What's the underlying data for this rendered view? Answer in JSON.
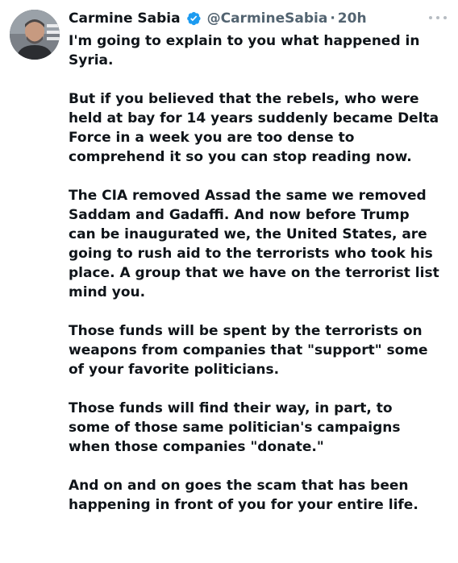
{
  "author": {
    "name": "Carmine Sabia",
    "handle": "@CarmineSabia",
    "separator": "·",
    "time": "20h",
    "verified_color": "#1d9bf0"
  },
  "icons": {
    "verified": "verified-badge-icon",
    "more": "more-options-icon"
  },
  "tweet": {
    "paragraphs": [
      "I'm going to explain to you what happened in\nSyria.",
      "But if you believed that the rebels, who were\nheld at bay for 14 years suddenly became Delta\nForce in a week you are too dense to\ncomprehend it so you can stop reading now.",
      "The CIA removed Assad the same we removed\nSaddam and Gadaffi. And now before Trump\ncan be inaugurated we, the United States, are\ngoing to rush aid to the terrorists who took his\nplace. A group that we have on the terrorist list\nmind you.",
      "Those funds will be spent by the terrorists on\nweapons from companies that \"support\" some\nof your favorite politicians.",
      "Those funds will find their way, in part, to\nsome of those same politician's campaigns\nwhen those companies \"donate.\"",
      "And on and on goes the scam that has been\nhappening in front of you for your entire life."
    ]
  }
}
